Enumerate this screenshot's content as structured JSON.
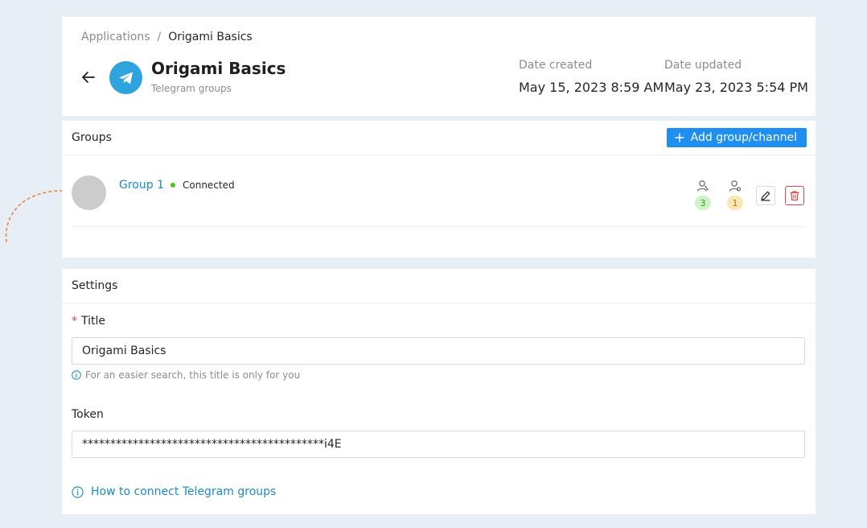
{
  "breadcrumb": {
    "parent": "Applications",
    "separator": "/",
    "current": "Origami Basics"
  },
  "app": {
    "title": "Origami Basics",
    "subtitle": "Telegram groups",
    "icon": "telegram-icon",
    "brand_color": "#2fa3dd"
  },
  "dates": {
    "created_label": "Date created",
    "created_value": "May 15, 2023 8:59 AM",
    "updated_label": "Date updated",
    "updated_value": "May 23, 2023 5:54 PM"
  },
  "groups": {
    "title": "Groups",
    "add_label": "Add group/channel",
    "accent": "#1f8ef1",
    "items": [
      {
        "name": "Group 1",
        "status": "Connected",
        "status_color": "#52c41a",
        "members": "3",
        "admins": "1"
      }
    ]
  },
  "settings": {
    "title": "Settings",
    "title_label": "Title",
    "required_mark": "*",
    "title_value": "Origami Basics",
    "title_hint": "For an easier search, this title is only for you",
    "token_label": "Token",
    "token_value": "*******************************************i4E",
    "help_link": "How to connect Telegram groups"
  }
}
